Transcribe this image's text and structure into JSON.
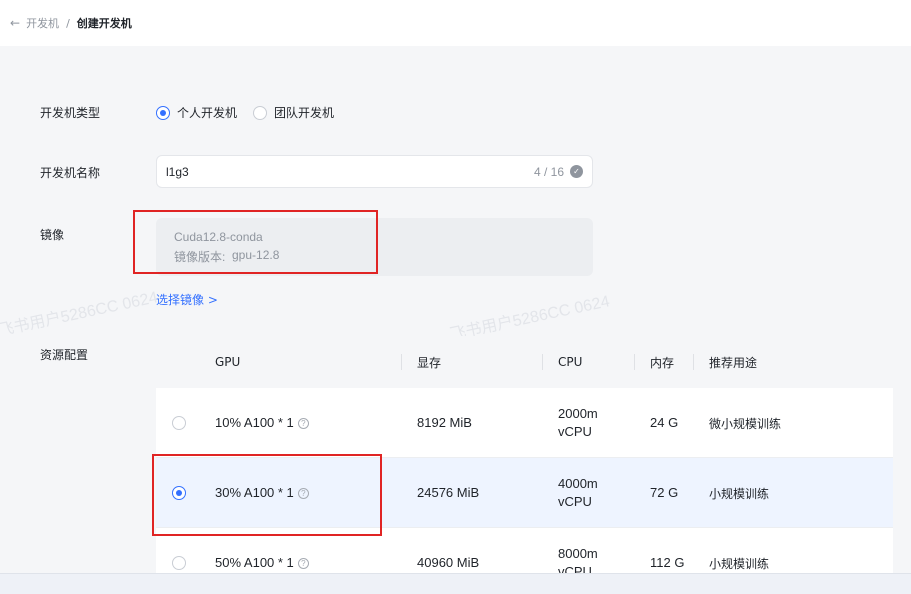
{
  "breadcrumb": {
    "back_icon": "arrow-left-icon",
    "prev": "开发机",
    "separator": "/",
    "current": "创建开发机"
  },
  "form": {
    "type_label": "开发机类型",
    "type_options": [
      "个人开发机",
      "团队开发机"
    ],
    "type_selected": "个人开发机",
    "name_label": "开发机名称",
    "name_value": "l1g3",
    "name_count": "4 / 16",
    "image_label": "镜像",
    "image_name": "Cuda12.8-conda",
    "image_version_label": "镜像版本:",
    "image_version_value": "gpu-12.8",
    "select_image_link": "选择镜像 >",
    "resource_label": "资源配置"
  },
  "table": {
    "headers": {
      "gpu": "GPU",
      "mem": "显存",
      "cpu": "CPU",
      "ram": "内存",
      "use": "推荐用途"
    },
    "rows": [
      {
        "gpu": "10% A100 * 1",
        "mem": "8192 MiB",
        "cpu_1": "2000m",
        "cpu_2": "vCPU",
        "ram": "24 G",
        "use": "微小规模训练",
        "selected": false
      },
      {
        "gpu": "30% A100 * 1",
        "mem": "24576 MiB",
        "cpu_1": "4000m",
        "cpu_2": "vCPU",
        "ram": "72 G",
        "use": "小规模训练",
        "selected": true
      },
      {
        "gpu": "50% A100 * 1",
        "mem": "40960 MiB",
        "cpu_1": "8000m",
        "cpu_2": "vCPU",
        "ram": "112 G",
        "use": "小规模训练",
        "selected": false
      }
    ]
  },
  "watermark": "飞书用户5286CC 0624",
  "colors": {
    "accent": "#3370ff",
    "highlight_border": "#e02424",
    "selected_row": "#eef4ff"
  }
}
